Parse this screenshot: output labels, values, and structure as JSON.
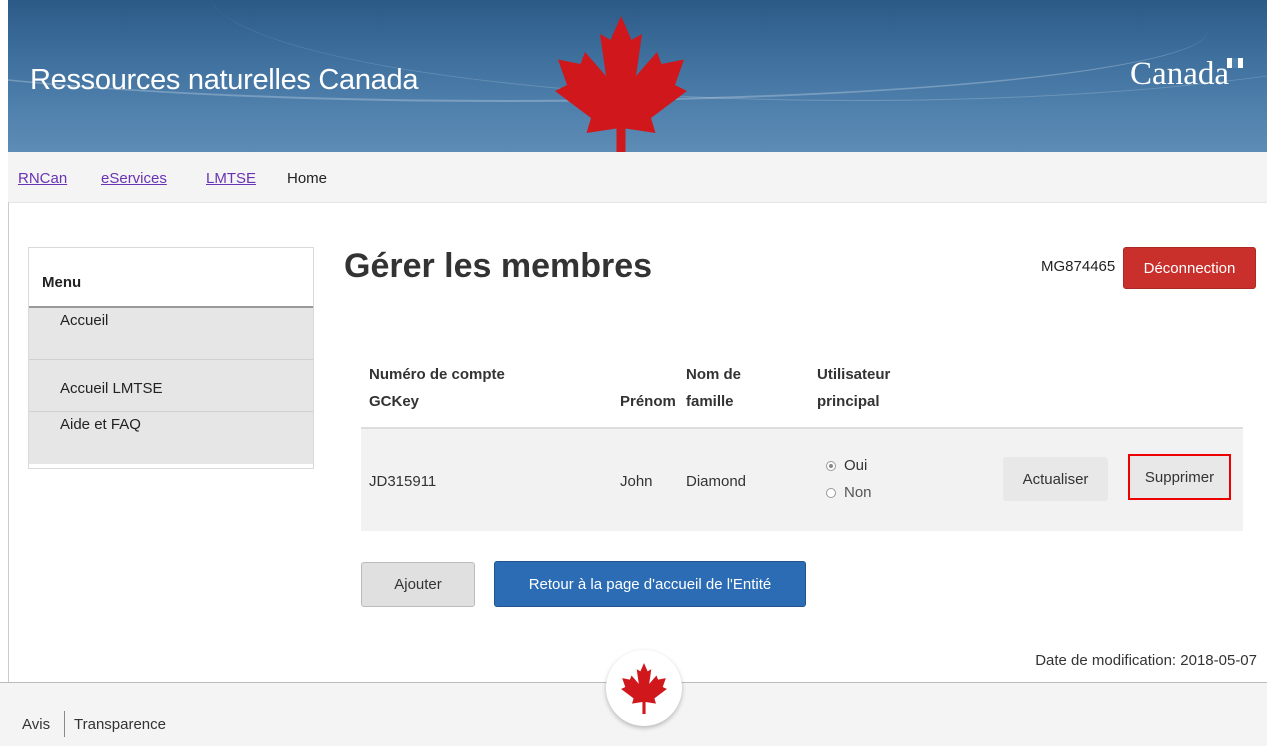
{
  "header": {
    "site_title": "Ressources naturelles Canada",
    "wordmark": "Canada",
    "colors": {
      "banner": "#3d6e9c",
      "maple": "#d0171b"
    }
  },
  "breadcrumb": {
    "items": [
      {
        "label": "RNCan",
        "link": true
      },
      {
        "label": "eServices",
        "link": true
      },
      {
        "label": "LMTSE",
        "link": true
      },
      {
        "label": "Home",
        "link": false
      }
    ]
  },
  "menu": {
    "title": "Menu",
    "items": [
      {
        "label": "Accueil"
      },
      {
        "label": "Accueil LMTSE"
      },
      {
        "label": "Aide et FAQ"
      }
    ]
  },
  "main": {
    "title": "Gérer les membres",
    "account_id": "MG874465",
    "logout_label": "Déconnection",
    "table": {
      "headers": [
        {
          "line1": "Numéro de compte",
          "line2": "GCKey"
        },
        {
          "line1": "",
          "line2": "Prénom"
        },
        {
          "line1": "Nom de",
          "line2": "famille"
        },
        {
          "line1": "Utilisateur",
          "line2": "principal"
        }
      ],
      "rows": [
        {
          "account": "JD315911",
          "first_name": "John",
          "last_name": "Diamond",
          "primary_options": [
            "Oui",
            "Non"
          ],
          "primary_selected": "Oui",
          "update_label": "Actualiser",
          "delete_label": "Supprimer"
        }
      ]
    },
    "add_label": "Ajouter",
    "return_label": "Retour à la page d'accueil de l'Entité",
    "date_modified": "Date de modification: 2018-05-07",
    "colors": {
      "logout": "#c9302c",
      "primary_button": "#2b6cb5",
      "highlight": "#e00000"
    }
  },
  "footer": {
    "links": [
      "Avis",
      "Transparence"
    ]
  }
}
